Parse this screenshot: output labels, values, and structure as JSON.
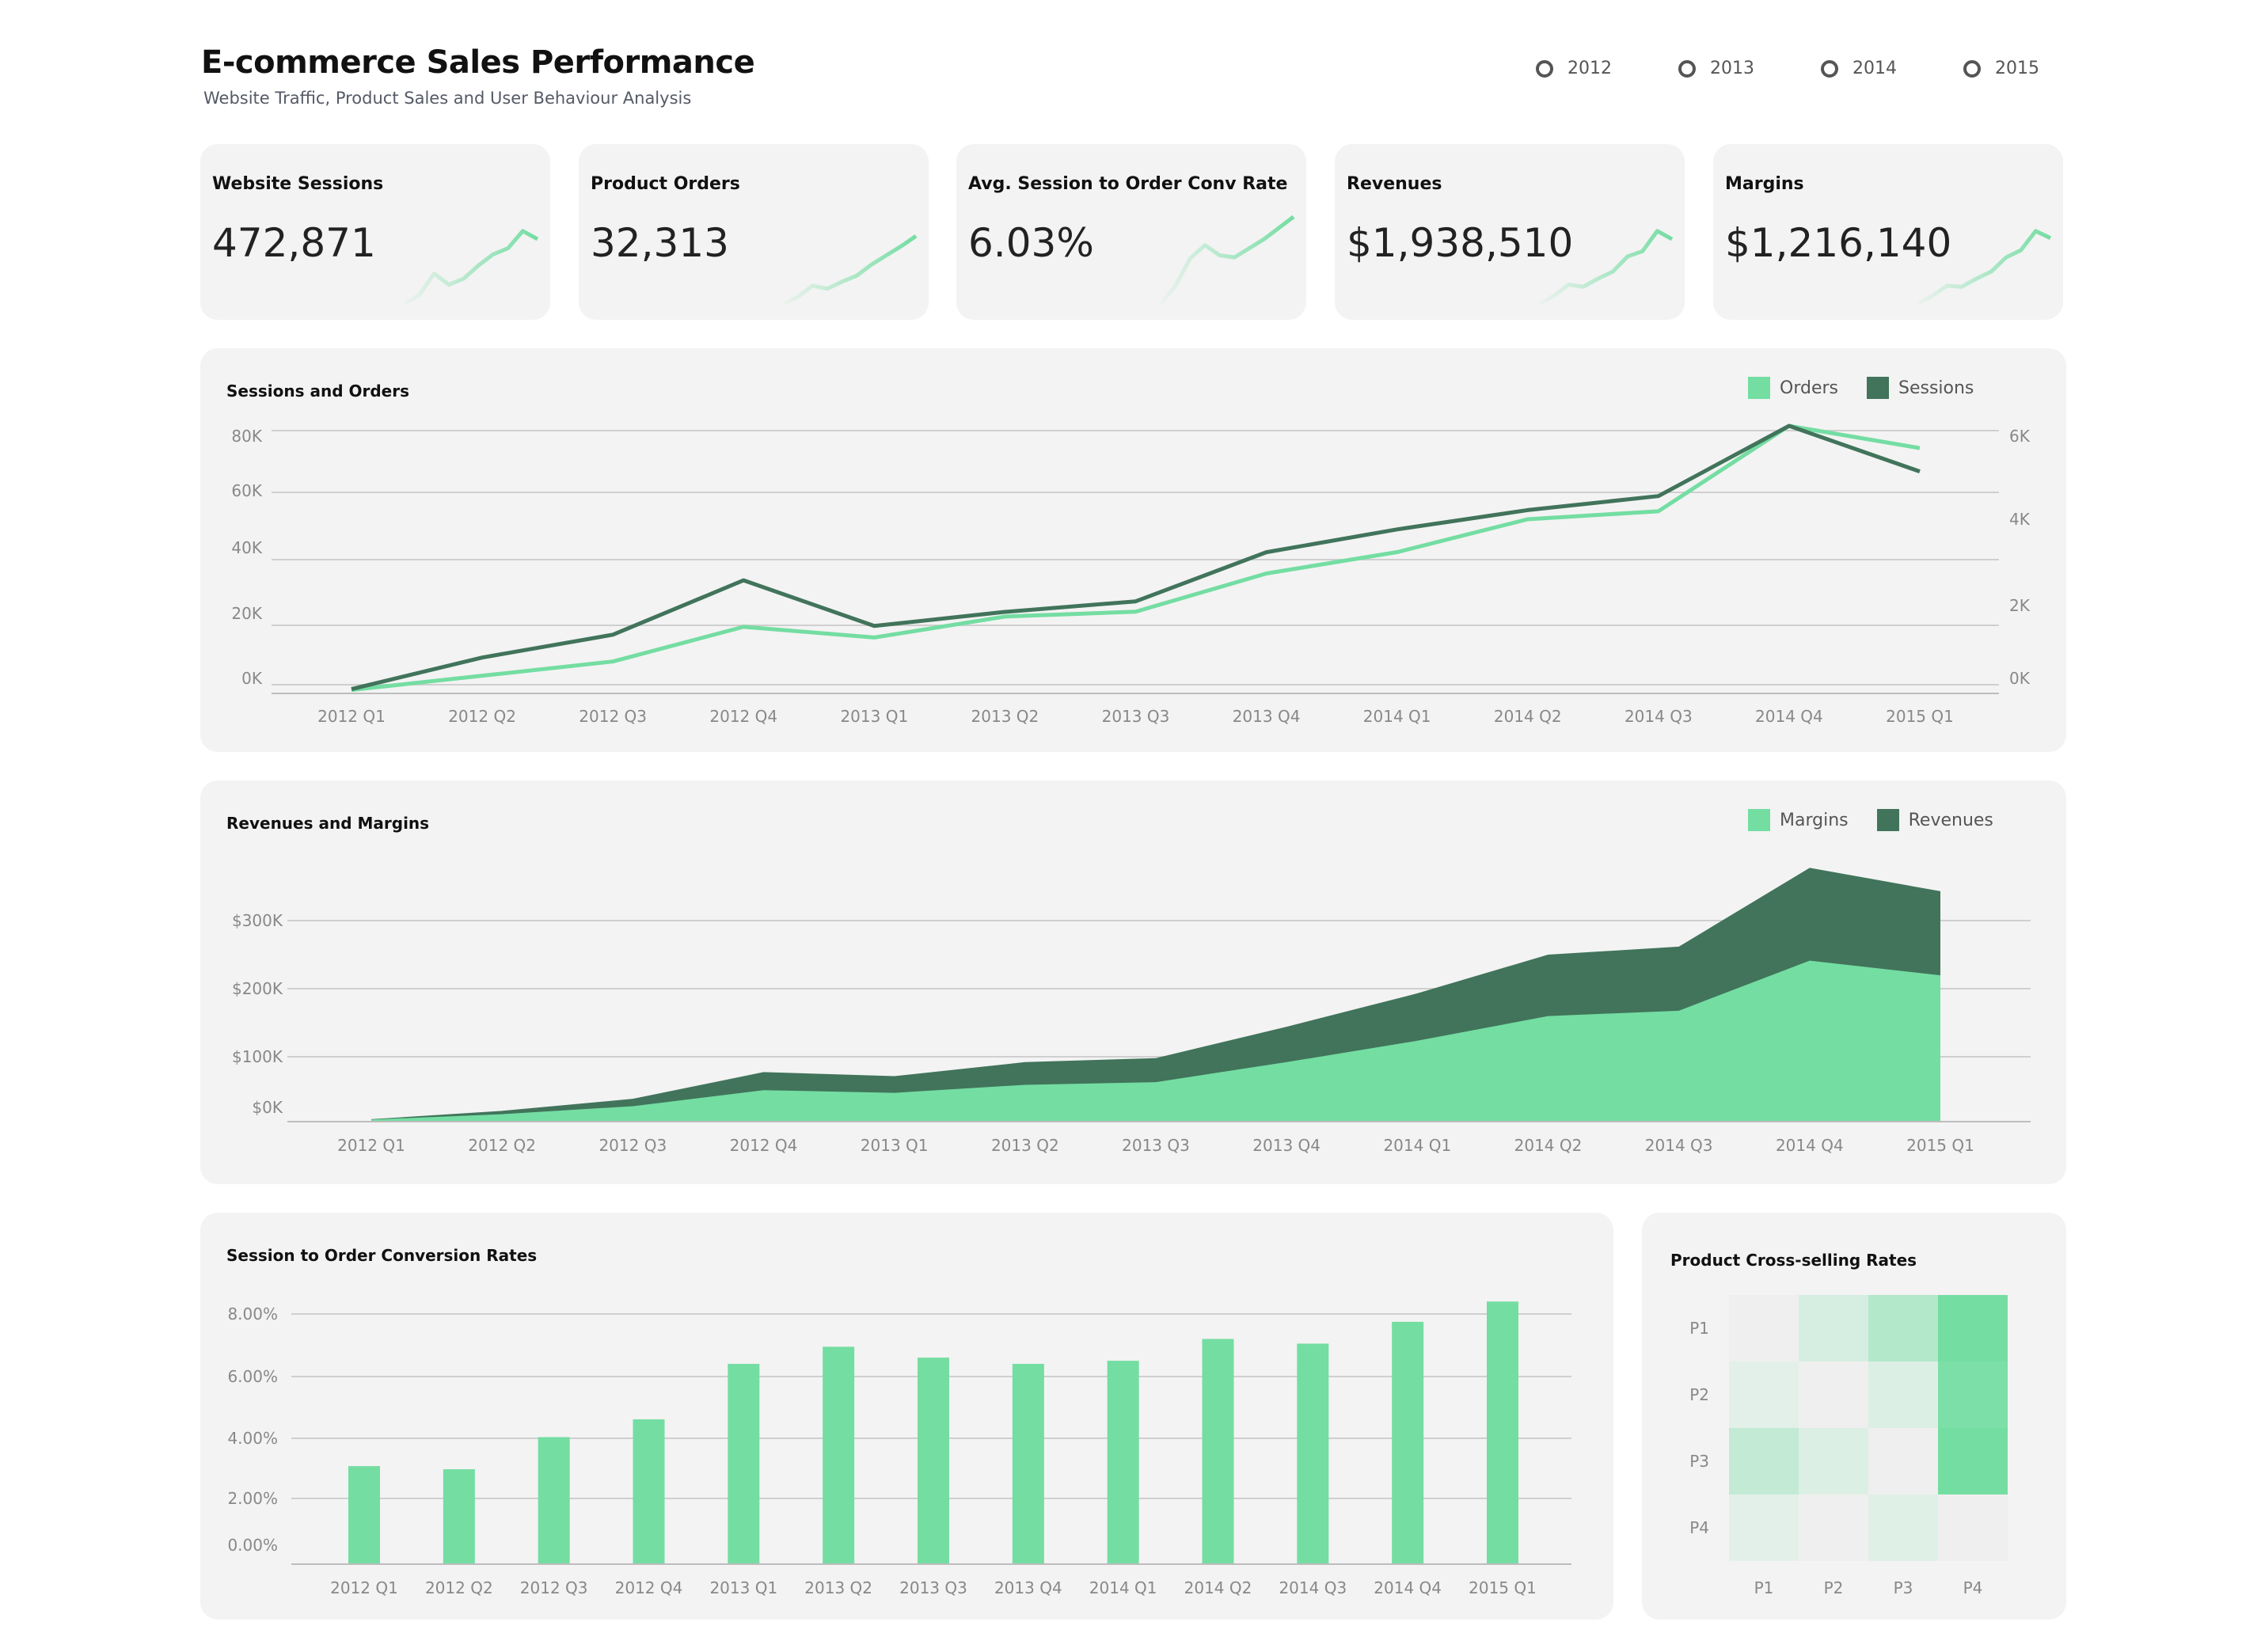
{
  "header": {
    "title": "E-commerce Sales Performance",
    "subtitle": "Website Traffic, Product Sales and User Behaviour Analysis"
  },
  "year_filter": {
    "options": [
      "2012",
      "2013",
      "2014",
      "2015"
    ]
  },
  "colors": {
    "light_green": "#74dda2",
    "dark_green": "#41745b",
    "card_bg": "#f3f3f3"
  },
  "kpis": [
    {
      "title": "Website Sessions",
      "value": "472,871",
      "trend": [
        0.0,
        0.09,
        0.3,
        0.19,
        0.25,
        0.38,
        0.49,
        0.55,
        0.72,
        0.64
      ]
    },
    {
      "title": "Product Orders",
      "value": "32,313",
      "trend": [
        0.0,
        0.07,
        0.18,
        0.15,
        0.22,
        0.28,
        0.39,
        0.48,
        0.57,
        0.67
      ]
    },
    {
      "title": "Avg. Session to Order Conv Rate",
      "value": "6.03%",
      "trend": [
        0.0,
        0.18,
        0.45,
        0.58,
        0.48,
        0.46,
        0.55,
        0.64,
        0.75,
        0.86
      ]
    },
    {
      "title": "Revenues",
      "value": "$1,938,510",
      "trend": [
        0.0,
        0.08,
        0.19,
        0.17,
        0.25,
        0.32,
        0.47,
        0.52,
        0.72,
        0.64
      ]
    },
    {
      "title": "Margins",
      "value": "$1,216,140",
      "trend": [
        0.0,
        0.08,
        0.18,
        0.17,
        0.25,
        0.32,
        0.46,
        0.53,
        0.72,
        0.65
      ]
    }
  ],
  "panels": {
    "sessions_orders": {
      "title": "Sessions and Orders"
    },
    "revenues_margins": {
      "title": "Revenues and Margins"
    },
    "conversion": {
      "title": "Session to Order Conversion Rates"
    },
    "cross_sell": {
      "title": "Product Cross-selling Rates"
    }
  },
  "chart_data": [
    {
      "type": "line",
      "title": "Sessions and Orders",
      "categories": [
        "2012 Q1",
        "2012 Q2",
        "2012 Q3",
        "2012 Q4",
        "2013 Q1",
        "2013 Q2",
        "2013 Q3",
        "2013 Q4",
        "2014 Q1",
        "2014 Q2",
        "2014 Q3",
        "2014 Q4",
        "2015 Q1"
      ],
      "series": [
        {
          "name": "Orders",
          "axis": "right",
          "color": "#74dda2",
          "values": [
            60,
            380,
            700,
            1480,
            1240,
            1710,
            1820,
            2680,
            3160,
            3900,
            4080,
            6000,
            5500
          ]
        },
        {
          "name": "Sessions",
          "axis": "left",
          "color": "#41745b",
          "values": [
            1000,
            10000,
            16500,
            32000,
            19000,
            23000,
            26000,
            40000,
            46500,
            52000,
            56000,
            76000,
            63000
          ]
        }
      ],
      "y_left": {
        "ticks": [
          "0K",
          "20K",
          "40K",
          "60K",
          "80K"
        ],
        "tick_values": [
          0,
          20000,
          40000,
          60000,
          80000
        ],
        "range": [
          0,
          76000
        ]
      },
      "y_right": {
        "ticks": [
          "0K",
          "2K",
          "4K",
          "6K"
        ],
        "tick_values": [
          0,
          2000,
          4000,
          6000
        ],
        "range": [
          0,
          6000
        ]
      },
      "legend": "top-right",
      "grid": true
    },
    {
      "type": "area",
      "title": "Revenues and Margins",
      "categories": [
        "2012 Q1",
        "2012 Q2",
        "2012 Q3",
        "2012 Q4",
        "2013 Q1",
        "2013 Q2",
        "2013 Q3",
        "2013 Q4",
        "2014 Q1",
        "2014 Q2",
        "2014 Q3",
        "2014 Q4",
        "2015 Q1"
      ],
      "series": [
        {
          "name": "Margins",
          "color": "#74dda2",
          "values": [
            2000,
            10000,
            22000,
            46000,
            42000,
            54000,
            58000,
            88000,
            120000,
            157000,
            165000,
            240000,
            218000
          ]
        },
        {
          "name": "Revenues",
          "color": "#41745b",
          "values": [
            2500,
            15000,
            33000,
            73000,
            67000,
            88000,
            94000,
            141000,
            191000,
            249000,
            261000,
            379000,
            344000
          ]
        }
      ],
      "y": {
        "ticks": [
          "$0K",
          "$100K",
          "$200K",
          "$300K"
        ],
        "tick_values": [
          0,
          100000,
          200000,
          300000
        ]
      },
      "legend": "top-right",
      "grid": true
    },
    {
      "type": "bar",
      "title": "Session to Order Conversion Rates",
      "categories": [
        "2012 Q1",
        "2012 Q2",
        "2012 Q3",
        "2012 Q4",
        "2013 Q1",
        "2013 Q2",
        "2013 Q3",
        "2013 Q4",
        "2014 Q1",
        "2014 Q2",
        "2014 Q3",
        "2014 Q4",
        "2015 Q1"
      ],
      "values": [
        3.12,
        3.02,
        4.05,
        4.62,
        6.4,
        6.95,
        6.6,
        6.4,
        6.5,
        7.2,
        7.05,
        7.75,
        8.4
      ],
      "y": {
        "ticks": [
          "0.00%",
          "2.00%",
          "4.00%",
          "6.00%",
          "8.00%"
        ],
        "tick_values": [
          0,
          2,
          4,
          6,
          8
        ]
      },
      "color": "#74dda2",
      "grid": true
    },
    {
      "type": "heatmap",
      "title": "Product Cross-selling Rates",
      "rows": [
        "P1",
        "P2",
        "P3",
        "P4"
      ],
      "cols": [
        "P1",
        "P2",
        "P3",
        "P4"
      ],
      "values": [
        [
          0.0,
          0.22,
          0.5,
          1.0
        ],
        [
          0.1,
          0.0,
          0.18,
          0.95
        ],
        [
          0.38,
          0.18,
          0.0,
          1.0
        ],
        [
          0.1,
          0.0,
          0.16,
          0.0
        ]
      ]
    }
  ]
}
